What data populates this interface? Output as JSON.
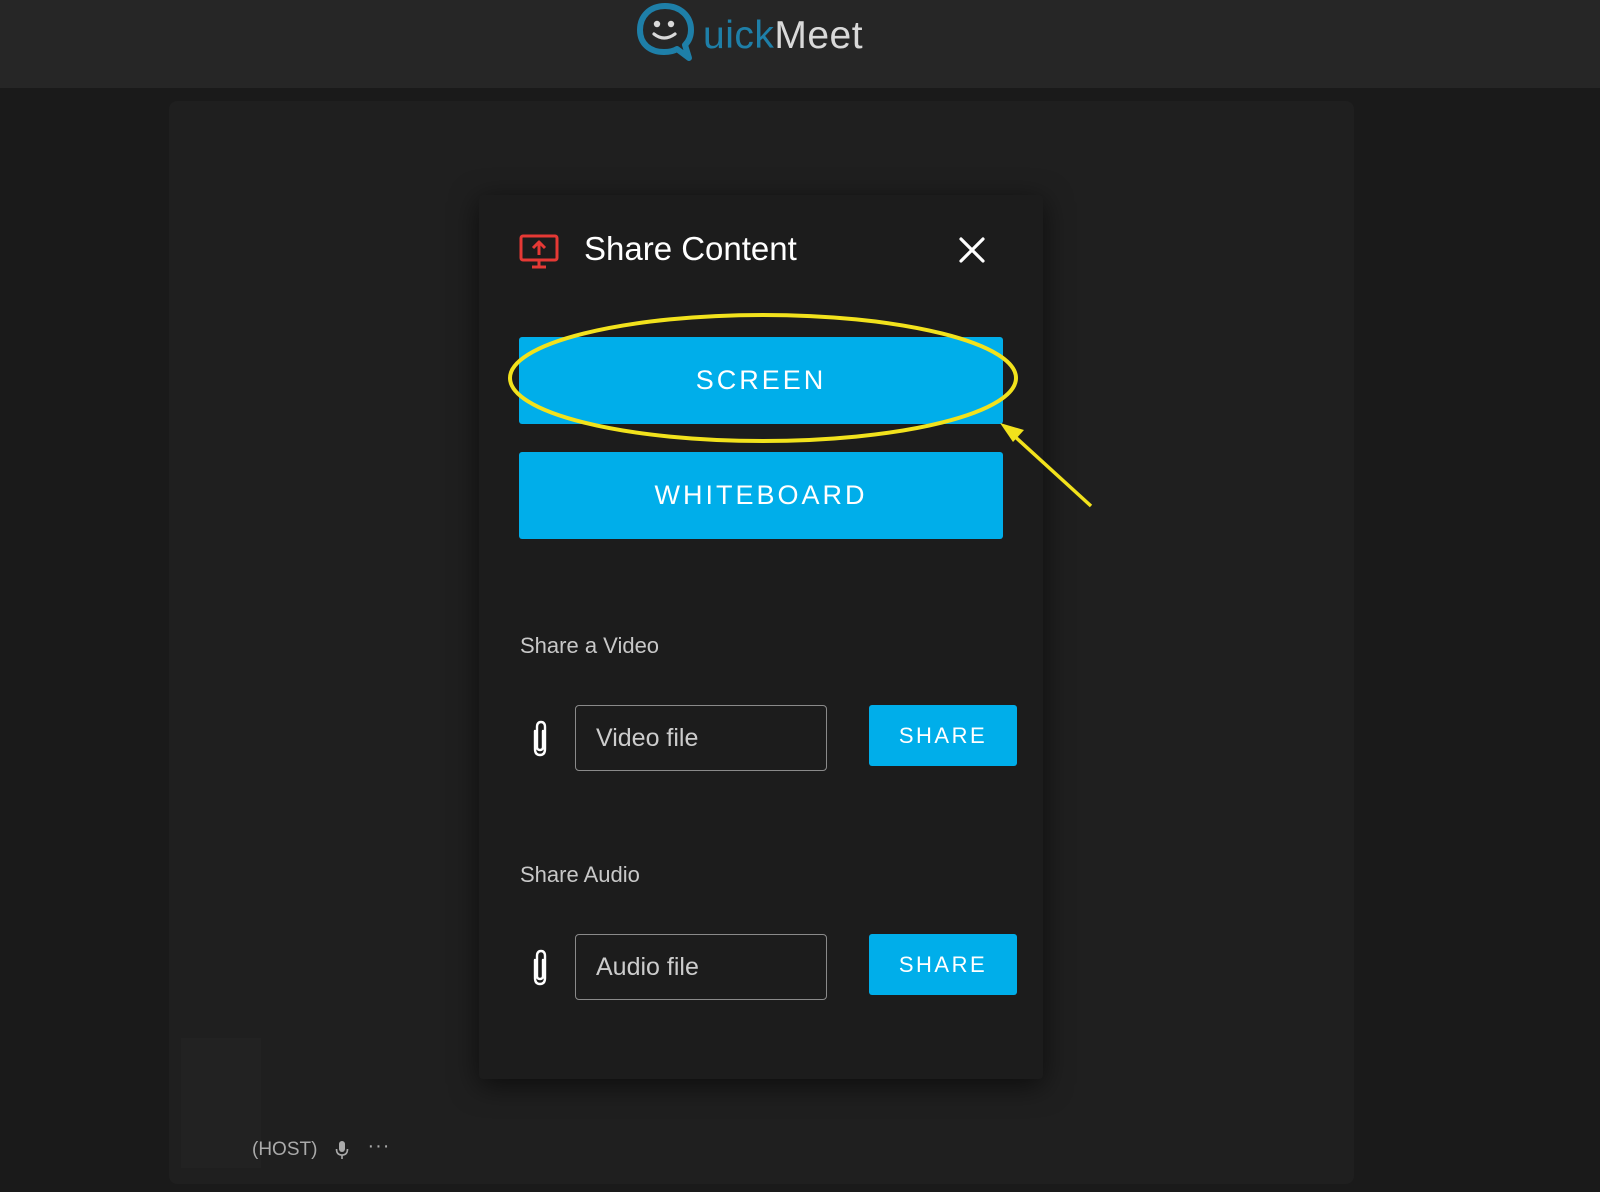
{
  "app": {
    "logo_first": "uick",
    "logo_second": "Meet",
    "logo_icon": "chat-bubble-smiley-icon",
    "brand_blue": "#1e7fa8"
  },
  "modal": {
    "title": "Share Content",
    "title_icon": "screen-share-icon",
    "title_icon_color": "#e53935",
    "close_icon": "close-icon",
    "screen_button": "SCREEN",
    "whiteboard_button": "WHITEBOARD",
    "accent_color": "#00aeea",
    "video": {
      "label": "Share a Video",
      "placeholder": "Video file",
      "button": "SHARE"
    },
    "audio": {
      "label": "Share Audio",
      "placeholder": "Audio file",
      "button": "SHARE"
    }
  },
  "participant": {
    "host_label": "(HOST)",
    "mic_icon": "microphone-icon",
    "more_icon": "more-options-icon",
    "more_glyph": "···"
  },
  "annotation": {
    "color": "#f2e21c",
    "shape": "ellipse-with-arrow",
    "target": "SCREEN"
  }
}
